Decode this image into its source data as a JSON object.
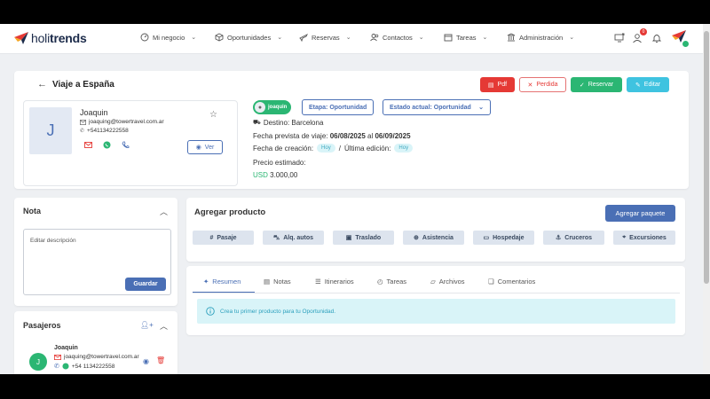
{
  "brand": {
    "prefix": "holi",
    "suffix": "trends"
  },
  "nav": [
    {
      "label": "Mi negocio",
      "icon": "gauge-icon"
    },
    {
      "label": "Oportunidades",
      "icon": "cube-icon"
    },
    {
      "label": "Reservas",
      "icon": "plane-icon"
    },
    {
      "label": "Contactos",
      "icon": "users-icon"
    },
    {
      "label": "Tareas",
      "icon": "calendar-icon"
    },
    {
      "label": "Administración",
      "icon": "bank-icon"
    }
  ],
  "notifications_count": "0",
  "page": {
    "title": "Viaje a España"
  },
  "actions": {
    "pdf": "Pdf",
    "perdida": "Perdida",
    "reservar": "Reservar",
    "editar": "Editar"
  },
  "contact": {
    "initial": "J",
    "name": "Joaquin",
    "email": "joaquing@towertravel.com.ar",
    "phone": "+541134222558",
    "ver": "Ver"
  },
  "trip": {
    "owner_chip": "joaquin",
    "etapa": "Etapa: Oportunidad",
    "estado": "Estado actual: Oportunidad",
    "destino": "Destino: Barcelona",
    "fecha_label": "Fecha prevista de viaje:",
    "fecha_desde": "06/08/2025",
    "fecha_al": "al",
    "fecha_hasta": "06/09/2025",
    "creacion_label": "Fecha de creación:",
    "creacion_badge": "Hoy",
    "edicion_sep": "/",
    "edicion_label": "Última edición:",
    "edicion_badge": "Hoy",
    "precio_label": "Precio estimado:",
    "precio_currency": "USD",
    "precio_value": "3.000,00"
  },
  "nota": {
    "title": "Nota",
    "placeholder": "Editar descripción",
    "save": "Guardar"
  },
  "pasajeros": {
    "title": "Pasajeros",
    "item": {
      "initial": "J",
      "name": "Joaquin",
      "email": "joaquing@towertravel.com.ar",
      "phone": "+54 1134222558"
    }
  },
  "agregar": {
    "title": "Agregar producto",
    "paquete": "Agregar paquete",
    "products": [
      "Pasaje",
      "Alq. autos",
      "Traslado",
      "Asistencia",
      "Hospedaje",
      "Cruceros",
      "Excursiones"
    ]
  },
  "tabs": [
    "Resumen",
    "Notas",
    "Itinerarios",
    "Tareas",
    "Archivos",
    "Comentarios"
  ],
  "info_message": "Crea tu primer producto para tu Oportunidad.",
  "colors": {
    "primary": "#4a6fb5",
    "green": "#2bb673",
    "red": "#e53935",
    "cyan": "#3fc3e0",
    "info_bg": "#d9f4f8"
  }
}
